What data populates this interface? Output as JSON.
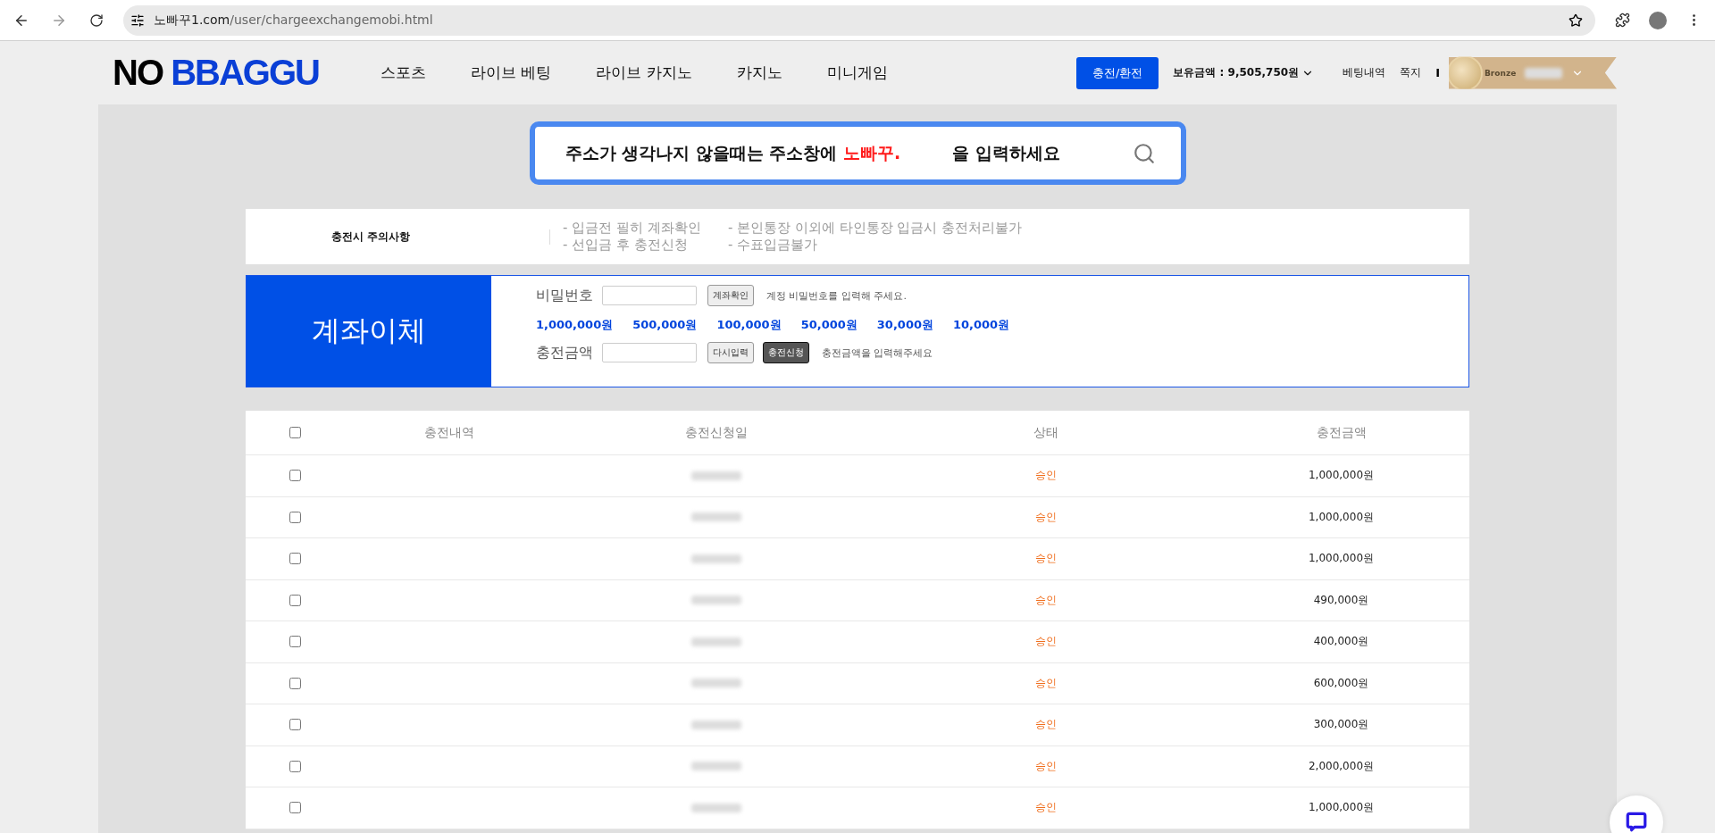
{
  "browser": {
    "url_host": "노빠꾸1.com",
    "url_path": "/user/chargeexchangemobi.html"
  },
  "header": {
    "logo_left": "NO",
    "logo_right": "BBAGGU",
    "nav": [
      "스포츠",
      "라이브 베팅",
      "라이브 카지노",
      "카지노",
      "미니게임"
    ],
    "charge_button": "충전/환전",
    "balance": "보유금액 : 9,505,750원",
    "links": [
      "베팅내역",
      "쪽지"
    ],
    "separator": "I",
    "rank": "Bronze"
  },
  "banner": {
    "before": "주소가 생각나지 않을때는 주소창에 ",
    "highlight": "노빠꾸.",
    "after": "을 입력하세요"
  },
  "notice": {
    "title": "충전시 주의사항",
    "items": [
      "- 입금전 필히 계좌확인",
      "- 본인통장 이외에 타인통장 입금시 충전처리불가",
      "- 선입금 후 충전신청",
      "- 수표입금불가"
    ]
  },
  "transfer": {
    "title": "계좌이체",
    "password_label": "비밀번호",
    "check_button": "계좌확인",
    "password_hint": "계정 비밀번호를 입력해 주세요.",
    "amounts": [
      "1,000,000원",
      "500,000원",
      "100,000원",
      "50,000원",
      "30,000원",
      "10,000원"
    ],
    "amount_label": "충전금액",
    "reset_button": "다시입력",
    "submit_button": "충전신청",
    "amount_hint": "충전금액을 입력해주세요"
  },
  "table": {
    "columns": [
      "충전내역",
      "충전신청일",
      "상태",
      "충전금액"
    ],
    "all_checked": false,
    "rows": [
      {
        "checked": false,
        "status": "승인",
        "amount": "1,000,000원"
      },
      {
        "checked": false,
        "status": "승인",
        "amount": "1,000,000원"
      },
      {
        "checked": false,
        "status": "승인",
        "amount": "1,000,000원"
      },
      {
        "checked": false,
        "status": "승인",
        "amount": "490,000원"
      },
      {
        "checked": false,
        "status": "승인",
        "amount": "400,000원"
      },
      {
        "checked": false,
        "status": "승인",
        "amount": "600,000원"
      },
      {
        "checked": false,
        "status": "승인",
        "amount": "300,000원"
      },
      {
        "checked": false,
        "status": "승인",
        "amount": "2,000,000원"
      },
      {
        "checked": false,
        "status": "승인",
        "amount": "1,000,000원"
      }
    ]
  }
}
